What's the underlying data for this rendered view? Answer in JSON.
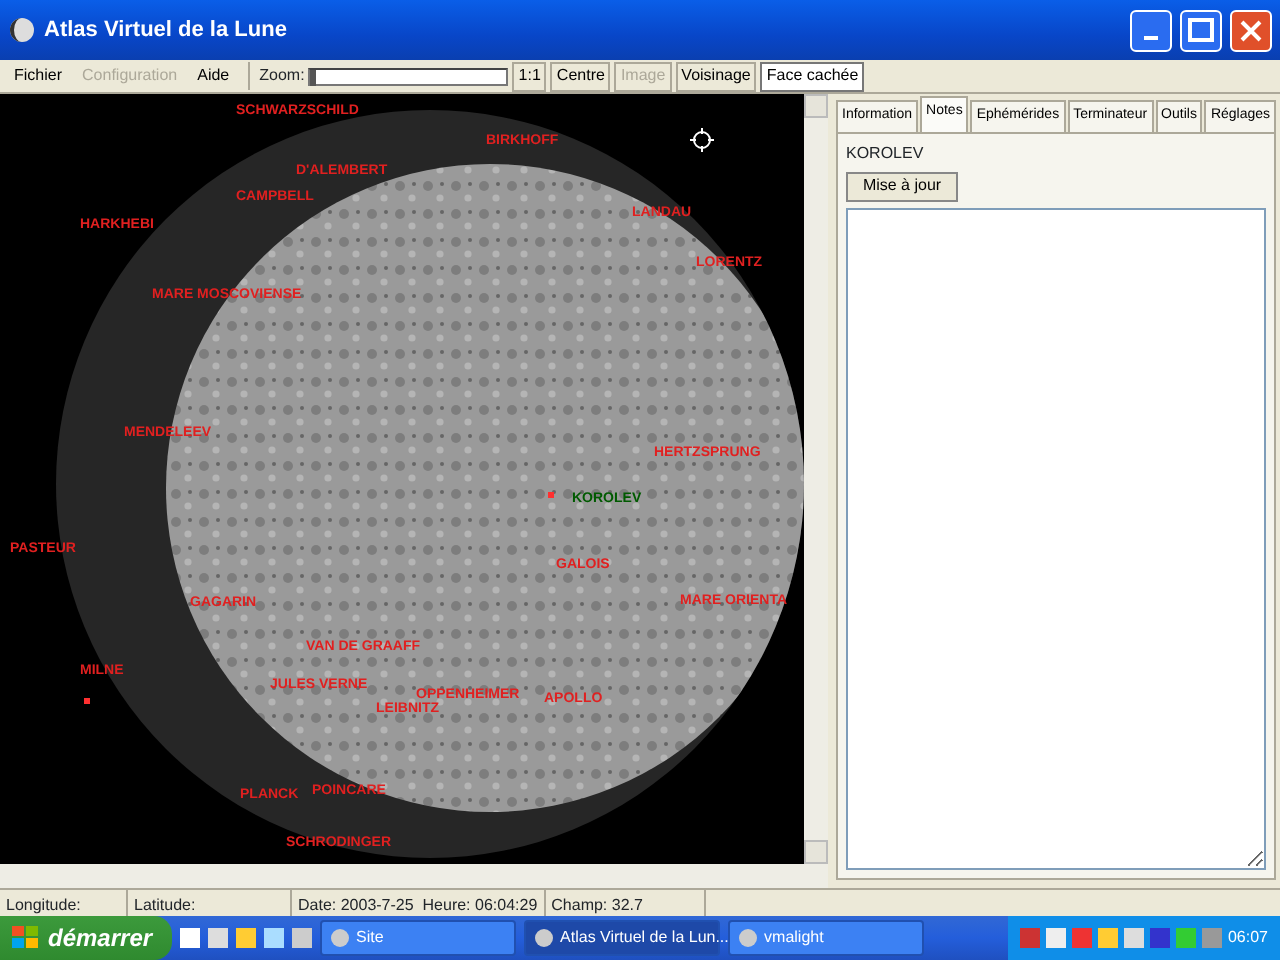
{
  "window": {
    "title": "Atlas Virtuel de la Lune"
  },
  "menu": [
    {
      "label": "Fichier",
      "disabled": false
    },
    {
      "label": "Configuration",
      "disabled": true
    },
    {
      "label": "Aide",
      "disabled": false
    }
  ],
  "zoom": {
    "label": "Zoom:",
    "level": 0
  },
  "toolbar": [
    {
      "label": "1:1",
      "disabled": false,
      "selected": false
    },
    {
      "label": "Centre",
      "disabled": false,
      "selected": false
    },
    {
      "label": "Image",
      "disabled": true,
      "selected": false
    },
    {
      "label": "Voisinage",
      "disabled": false,
      "selected": false
    },
    {
      "label": "Face cachée",
      "disabled": false,
      "selected": true
    }
  ],
  "map": {
    "labels": [
      {
        "text": "SCHWARZSCHILD",
        "selected": false
      },
      {
        "text": "BIRKHOFF",
        "selected": false
      },
      {
        "text": "D'ALEMBERT",
        "selected": false
      },
      {
        "text": "CAMPBELL",
        "selected": false
      },
      {
        "text": "LANDAU",
        "selected": false
      },
      {
        "text": "HARKHEBI",
        "selected": false
      },
      {
        "text": "LORENTZ",
        "selected": false
      },
      {
        "text": "MARE MOSCOVIENSE",
        "selected": false
      },
      {
        "text": "MENDELEEV",
        "selected": false
      },
      {
        "text": "HERTZSPRUNG",
        "selected": false
      },
      {
        "text": "KOROLEV",
        "selected": true
      },
      {
        "text": "PASTEUR",
        "selected": false
      },
      {
        "text": "GALOIS",
        "selected": false
      },
      {
        "text": "GAGARIN",
        "selected": false
      },
      {
        "text": "MARE ORIENTA",
        "selected": false
      },
      {
        "text": "VAN DE GRAAFF",
        "selected": false
      },
      {
        "text": "MILNE",
        "selected": false
      },
      {
        "text": "JULES VERNE",
        "selected": false
      },
      {
        "text": "OPPENHEIMER",
        "selected": false
      },
      {
        "text": "APOLLO",
        "selected": false
      },
      {
        "text": "LEIBNITZ",
        "selected": false
      },
      {
        "text": "PLANCK",
        "selected": false
      },
      {
        "text": "POINCARE",
        "selected": false
      },
      {
        "text": "SCHRODINGER",
        "selected": false
      }
    ]
  },
  "panel": {
    "tabs": [
      {
        "label": "Information",
        "selected": false
      },
      {
        "label": "Notes",
        "selected": true
      },
      {
        "label": "Ephémérides",
        "selected": false
      },
      {
        "label": "Terminateur",
        "selected": false
      },
      {
        "label": "Outils",
        "selected": false
      },
      {
        "label": "Réglages",
        "selected": false
      }
    ],
    "feature_name": "KOROLEV",
    "update_button": "Mise à jour"
  },
  "status_bar": [
    "Longitude:",
    "Latitude:",
    "Date: 2003-7-25  Heure: 06:04:29",
    "Champ: 32.7"
  ],
  "taskbar": {
    "start": "démarrer",
    "tasks": [
      {
        "label": "Site",
        "selected": false
      },
      {
        "label": "Atlas Virtuel de la Lun...",
        "selected": true
      },
      {
        "label": "vmalight",
        "selected": false
      }
    ],
    "clock": "06:07"
  }
}
